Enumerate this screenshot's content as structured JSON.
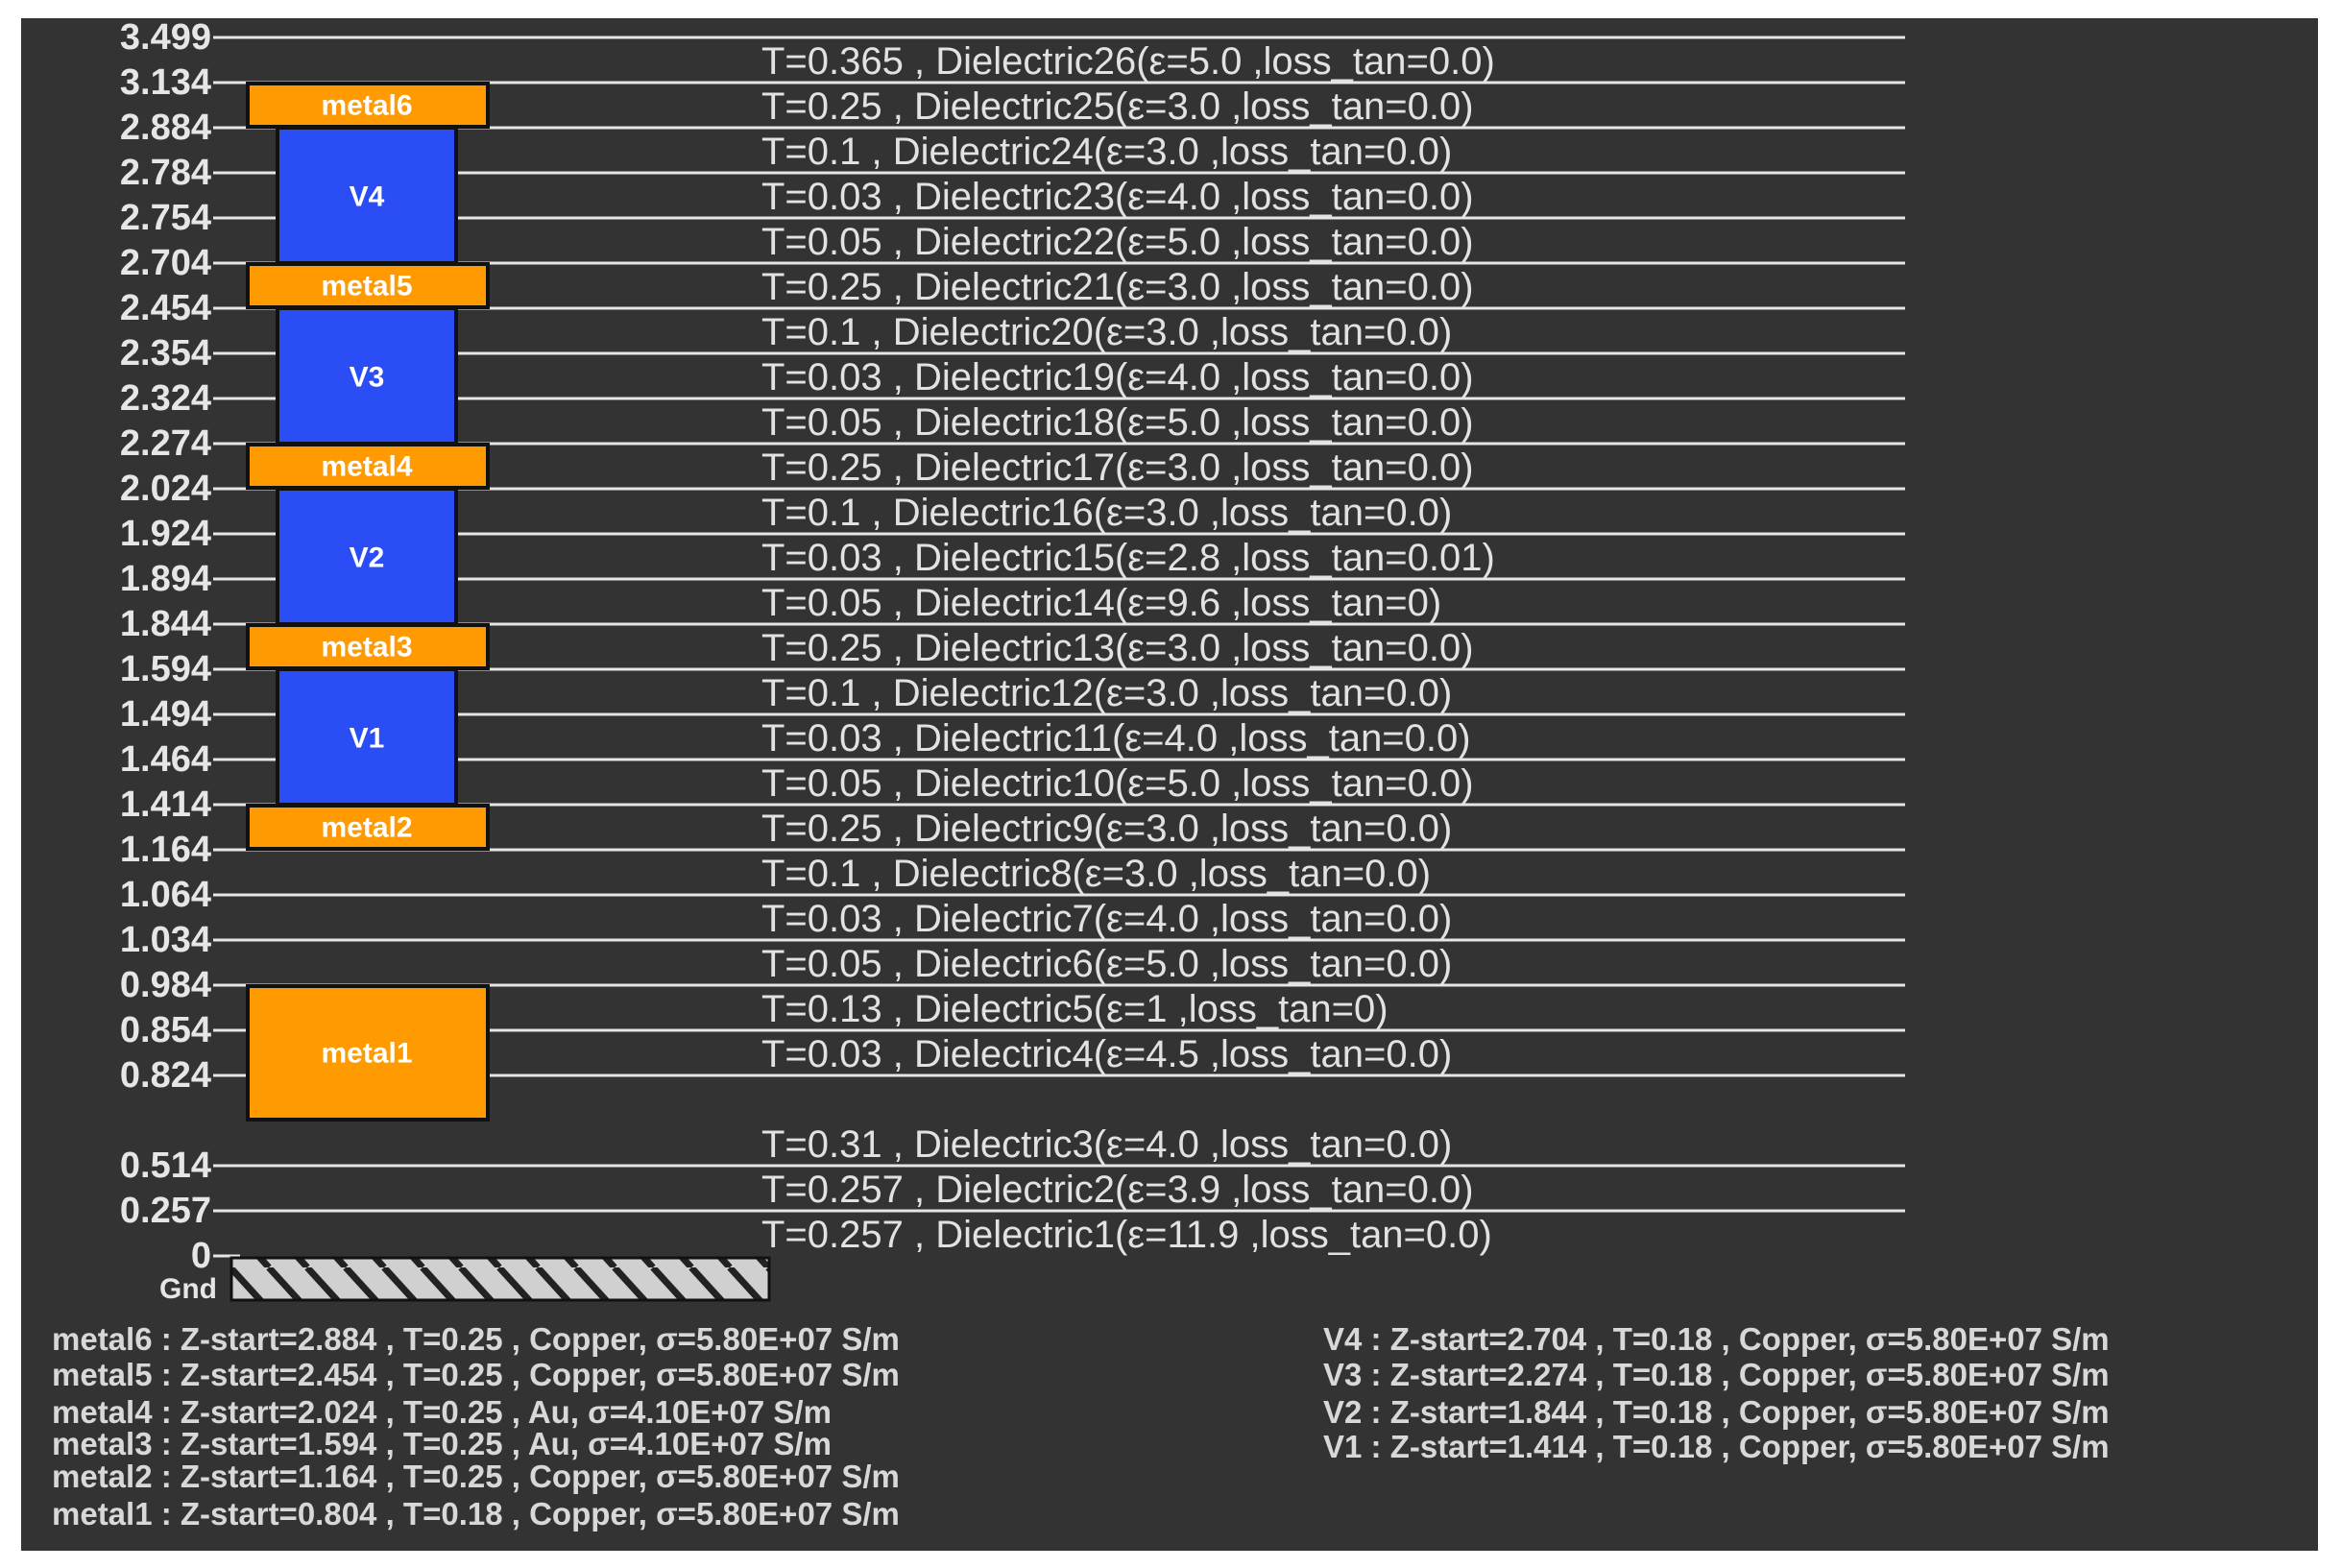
{
  "colors": {
    "background": "#333333",
    "metal": "#ff9a00",
    "via": "#2b4df5",
    "line": "#e6e6e6",
    "text": "#e2e2e2"
  },
  "axis": {
    "ticks": [
      "3.499",
      "3.134",
      "2.884",
      "2.784",
      "2.754",
      "2.704",
      "2.454",
      "2.354",
      "2.324",
      "2.274",
      "2.024",
      "1.924",
      "1.894",
      "1.844",
      "1.594",
      "1.494",
      "1.464",
      "1.414",
      "1.164",
      "1.064",
      "1.034",
      "0.984",
      "0.854",
      "0.824",
      "0.514",
      "0.257",
      "0"
    ],
    "ground_label": "Gnd"
  },
  "dielectrics": [
    {
      "z_bottom": 3.134,
      "label": "T=0.365 , Dielectric26(ε=5.0 ,loss_tan=0.0)"
    },
    {
      "z_bottom": 2.884,
      "label": "T=0.25 , Dielectric25(ε=3.0 ,loss_tan=0.0)"
    },
    {
      "z_bottom": 2.784,
      "label": "T=0.1 , Dielectric24(ε=3.0 ,loss_tan=0.0)"
    },
    {
      "z_bottom": 2.754,
      "label": "T=0.03 , Dielectric23(ε=4.0 ,loss_tan=0.0)"
    },
    {
      "z_bottom": 2.704,
      "label": "T=0.05 , Dielectric22(ε=5.0 ,loss_tan=0.0)"
    },
    {
      "z_bottom": 2.454,
      "label": "T=0.25 , Dielectric21(ε=3.0 ,loss_tan=0.0)"
    },
    {
      "z_bottom": 2.354,
      "label": "T=0.1 , Dielectric20(ε=3.0 ,loss_tan=0.0)"
    },
    {
      "z_bottom": 2.324,
      "label": "T=0.03 , Dielectric19(ε=4.0 ,loss_tan=0.0)"
    },
    {
      "z_bottom": 2.274,
      "label": "T=0.05 , Dielectric18(ε=5.0 ,loss_tan=0.0)"
    },
    {
      "z_bottom": 2.024,
      "label": "T=0.25 , Dielectric17(ε=3.0 ,loss_tan=0.0)"
    },
    {
      "z_bottom": 1.924,
      "label": "T=0.1 , Dielectric16(ε=3.0 ,loss_tan=0.0)"
    },
    {
      "z_bottom": 1.894,
      "label": "T=0.03 , Dielectric15(ε=2.8 ,loss_tan=0.01)"
    },
    {
      "z_bottom": 1.844,
      "label": "T=0.05 , Dielectric14(ε=9.6 ,loss_tan=0)"
    },
    {
      "z_bottom": 1.594,
      "label": "T=0.25 , Dielectric13(ε=3.0 ,loss_tan=0.0)"
    },
    {
      "z_bottom": 1.494,
      "label": "T=0.1 , Dielectric12(ε=3.0 ,loss_tan=0.0)"
    },
    {
      "z_bottom": 1.464,
      "label": "T=0.03 , Dielectric11(ε=4.0 ,loss_tan=0.0)"
    },
    {
      "z_bottom": 1.414,
      "label": "T=0.05 , Dielectric10(ε=5.0 ,loss_tan=0.0)"
    },
    {
      "z_bottom": 1.164,
      "label": "T=0.25 , Dielectric9(ε=3.0 ,loss_tan=0.0)"
    },
    {
      "z_bottom": 1.064,
      "label": "T=0.1 , Dielectric8(ε=3.0 ,loss_tan=0.0)"
    },
    {
      "z_bottom": 1.034,
      "label": "T=0.03 , Dielectric7(ε=4.0 ,loss_tan=0.0)"
    },
    {
      "z_bottom": 0.984,
      "label": "T=0.05 , Dielectric6(ε=5.0 ,loss_tan=0.0)"
    },
    {
      "z_bottom": 0.854,
      "label": "T=0.13 , Dielectric5(ε=1 ,loss_tan=0)"
    },
    {
      "z_bottom": 0.824,
      "label": "T=0.03 , Dielectric4(ε=4.5 ,loss_tan=0.0)"
    },
    {
      "z_bottom": 0.514,
      "label": "T=0.31 , Dielectric3(ε=4.0 ,loss_tan=0.0)"
    },
    {
      "z_bottom": 0.257,
      "label": "T=0.257 , Dielectric2(ε=3.9 ,loss_tan=0.0)"
    },
    {
      "z_bottom": 0,
      "label": "T=0.257 , Dielectric1(ε=11.9 ,loss_tan=0.0)"
    }
  ],
  "metals": [
    {
      "name": "metal6",
      "z_start": 2.884,
      "t": 0.25
    },
    {
      "name": "metal5",
      "z_start": 2.454,
      "t": 0.25
    },
    {
      "name": "metal4",
      "z_start": 2.024,
      "t": 0.25
    },
    {
      "name": "metal3",
      "z_start": 1.594,
      "t": 0.25
    },
    {
      "name": "metal2",
      "z_start": 1.164,
      "t": 0.25
    },
    {
      "name": "metal1",
      "z_start": 0.804,
      "t": 0.18
    }
  ],
  "vias": [
    {
      "name": "V4",
      "z_start": 2.704,
      "t": 0.18
    },
    {
      "name": "V3",
      "z_start": 2.274,
      "t": 0.18
    },
    {
      "name": "V2",
      "z_start": 1.844,
      "t": 0.18
    },
    {
      "name": "V1",
      "z_start": 1.414,
      "t": 0.18
    }
  ],
  "legend": {
    "metals": [
      "metal6 : Z-start=2.884 , T=0.25 , Copper, σ=5.80E+07 S/m",
      "metal5 : Z-start=2.454 , T=0.25 , Copper, σ=5.80E+07 S/m",
      "metal4 : Z-start=2.024 , T=0.25 , Au, σ=4.10E+07 S/m",
      "metal3 : Z-start=1.594 , T=0.25 , Au, σ=4.10E+07 S/m",
      "metal2 : Z-start=1.164 , T=0.25 , Copper, σ=5.80E+07 S/m",
      "metal1 : Z-start=0.804 , T=0.18 , Copper, σ=5.80E+07 S/m"
    ],
    "vias": [
      "V4 : Z-start=2.704 , T=0.18 , Copper, σ=5.80E+07 S/m",
      "V3 : Z-start=2.274 , T=0.18 , Copper, σ=5.80E+07 S/m",
      "V2 : Z-start=1.844 , T=0.18 , Copper, σ=5.80E+07 S/m",
      "V1 : Z-start=1.414 , T=0.18 , Copper, σ=5.80E+07 S/m"
    ]
  }
}
